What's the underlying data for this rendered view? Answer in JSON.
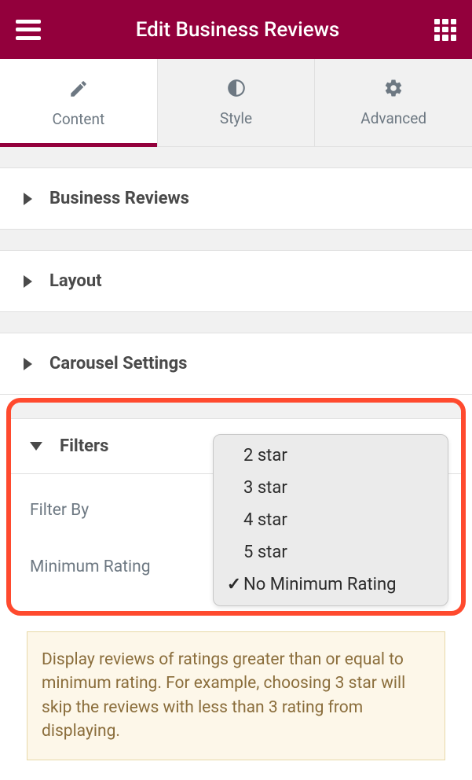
{
  "header": {
    "title": "Edit Business Reviews"
  },
  "tabs": [
    {
      "label": "Content",
      "icon": "pencil",
      "active": true
    },
    {
      "label": "Style",
      "icon": "contrast",
      "active": false
    },
    {
      "label": "Advanced",
      "icon": "gear",
      "active": false
    }
  ],
  "sections": {
    "business_reviews": {
      "title": "Business Reviews",
      "expanded": false
    },
    "layout": {
      "title": "Layout",
      "expanded": false
    },
    "carousel_settings": {
      "title": "Carousel Settings",
      "expanded": false
    },
    "filters": {
      "title": "Filters",
      "expanded": true,
      "fields": {
        "filter_by": {
          "label": "Filter By"
        },
        "minimum_rating": {
          "label": "Minimum Rating"
        }
      }
    }
  },
  "dropdown": {
    "options": [
      {
        "label": "2 star",
        "selected": false
      },
      {
        "label": "3 star",
        "selected": false
      },
      {
        "label": "4 star",
        "selected": false
      },
      {
        "label": "5 star",
        "selected": false
      },
      {
        "label": "No Minimum Rating",
        "selected": true
      }
    ]
  },
  "info_text": "Display reviews of ratings greater than or equal to minimum rating. For example, choosing 3 star will skip the reviews with less than 3 rating from displaying.",
  "colors": {
    "brand": "#93003c",
    "highlight": "#ff4a2e"
  }
}
